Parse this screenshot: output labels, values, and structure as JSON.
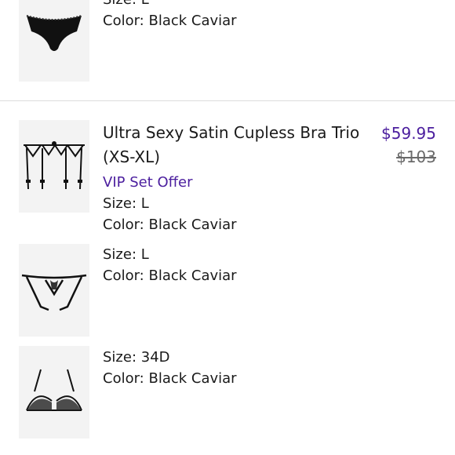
{
  "items": [
    {
      "size": "Size: L",
      "color": "Color: Black Caviar",
      "image_icon": "panty-icon"
    },
    {
      "title": "Ultra Sexy Satin Cupless Bra Trio (XS-XL)",
      "price": "$59.95",
      "original_price": "$103",
      "offer": "VIP Set Offer",
      "size": "Size: L",
      "color": "Color: Black Caviar",
      "image_icon": "garter-belt-icon"
    },
    {
      "size": "Size: L",
      "color": "Color: Black Caviar",
      "image_icon": "crotchless-panty-icon"
    },
    {
      "size": "Size: 34D",
      "color": "Color: Black Caviar",
      "image_icon": "cupless-bra-icon"
    }
  ],
  "colors": {
    "accent": "#4b1e9e",
    "strike": "#6a6a6a",
    "thumb_bg": "#f3f3f3",
    "divider": "#dcdcdc"
  }
}
